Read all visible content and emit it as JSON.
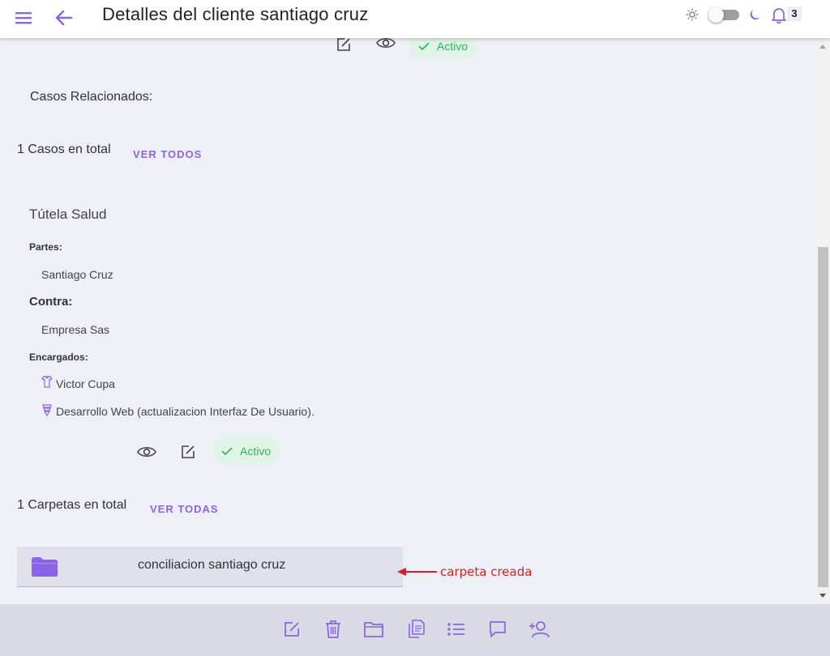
{
  "header": {
    "title": "Detalles del cliente santiago cruz",
    "notifications_count": "3",
    "theme_dark": false
  },
  "top_row": {
    "status_label": "Activo"
  },
  "related_cases": {
    "heading": "Casos Relacionados:",
    "total_text": "1 Casos en total",
    "view_all_label": "VER TODOS",
    "case": {
      "title": "Tútela Salud",
      "parties_label": "Partes:",
      "party": "Santiago Cruz",
      "against_label": "Contra:",
      "against": "Empresa Sas",
      "managers_label": "Encargados:",
      "manager_1": "Victor Cupa",
      "manager_2": "Desarrollo Web (actualizacion Interfaz De Usuario).",
      "status_label": "Activo"
    }
  },
  "folders": {
    "total_text": "1 Carpetas en total",
    "view_all_label": "VER TODAS",
    "items": [
      {
        "name": "conciliacion santiago cruz"
      }
    ]
  },
  "annotation": {
    "text": "carpeta creada",
    "color": "#d92020"
  },
  "colors": {
    "accent": "#8a63e6",
    "success_bg": "#dff3e6",
    "success_text": "#2eb35a",
    "background": "#eef0f8"
  },
  "icons": {
    "header": [
      "menu-icon",
      "back-arrow-icon",
      "sun-icon",
      "moon-icon",
      "bell-icon"
    ],
    "bottom_bar": [
      "edit-icon",
      "trash-icon",
      "folder-icon",
      "documents-icon",
      "list-icon",
      "chat-icon",
      "add-user-icon"
    ]
  }
}
